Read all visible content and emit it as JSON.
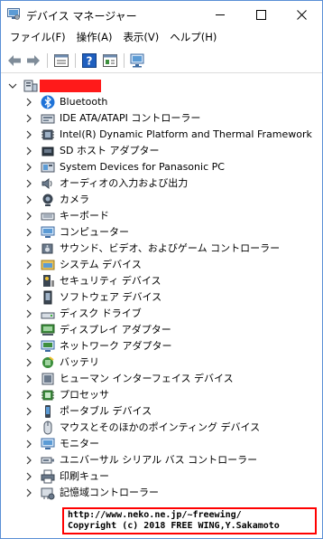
{
  "window": {
    "title": "デバイス マネージャー",
    "minimize_label": "—",
    "maximize_label": "☐",
    "close_label": "✕"
  },
  "menu": [
    {
      "label": "ファイル(F)"
    },
    {
      "label": "操作(A)"
    },
    {
      "label": "表示(V)"
    },
    {
      "label": "ヘルプ(H)"
    }
  ],
  "toolbar": {
    "back_icon": "arrow-left-icon",
    "forward_icon": "arrow-right-icon",
    "properties_icon": "properties-icon",
    "help_icon": "help-icon",
    "view_icon": "view-icon",
    "scan_icon": "monitor-scan-icon",
    "help_glyph": "?"
  },
  "tree": {
    "root_name": "",
    "root_name_redacted": true,
    "categories": [
      {
        "label": "Bluetooth",
        "icon": "bluetooth-icon"
      },
      {
        "label": "IDE ATA/ATAPI コントローラー",
        "icon": "ide-controller-icon"
      },
      {
        "label": "Intel(R) Dynamic Platform and Thermal Framework",
        "icon": "chip-icon"
      },
      {
        "label": "SD ホスト アダプター",
        "icon": "sd-card-icon"
      },
      {
        "label": "System Devices for Panasonic PC",
        "icon": "system-device-icon"
      },
      {
        "label": "オーディオの入力および出力",
        "icon": "speaker-icon"
      },
      {
        "label": "カメラ",
        "icon": "camera-icon"
      },
      {
        "label": "キーボード",
        "icon": "keyboard-icon"
      },
      {
        "label": "コンピューター",
        "icon": "computer-icon"
      },
      {
        "label": "サウンド、ビデオ、およびゲーム コントローラー",
        "icon": "sound-icon"
      },
      {
        "label": "システム デバイス",
        "icon": "system-folder-icon"
      },
      {
        "label": "セキュリティ デバイス",
        "icon": "security-key-icon"
      },
      {
        "label": "ソフトウェア デバイス",
        "icon": "software-device-icon"
      },
      {
        "label": "ディスク ドライブ",
        "icon": "disk-drive-icon"
      },
      {
        "label": "ディスプレイ アダプター",
        "icon": "display-adapter-icon"
      },
      {
        "label": "ネットワーク アダプター",
        "icon": "network-adapter-icon"
      },
      {
        "label": "バッテリ",
        "icon": "battery-icon"
      },
      {
        "label": "ヒューマン インターフェイス デバイス",
        "icon": "hid-icon"
      },
      {
        "label": "プロセッサ",
        "icon": "processor-icon"
      },
      {
        "label": "ポータブル デバイス",
        "icon": "portable-device-icon"
      },
      {
        "label": "マウスとそのほかのポインティング デバイス",
        "icon": "mouse-icon"
      },
      {
        "label": "モニター",
        "icon": "monitor-icon"
      },
      {
        "label": "ユニバーサル シリアル バス コントローラー",
        "icon": "usb-icon"
      },
      {
        "label": "印刷キュー",
        "icon": "printer-icon"
      },
      {
        "label": "記憶域コントローラー",
        "icon": "storage-controller-icon"
      }
    ]
  },
  "watermark": {
    "url": "http://www.neko.ne.jp/~freewing/",
    "copyright": "Copyright (c) 2018 FREE WING,Y.Sakamoto"
  },
  "colors": {
    "border": "#5a8fd6",
    "accent_blue": "#1e73d2",
    "redaction": "#ff1a1a",
    "watermark_border": "#ff0000"
  }
}
